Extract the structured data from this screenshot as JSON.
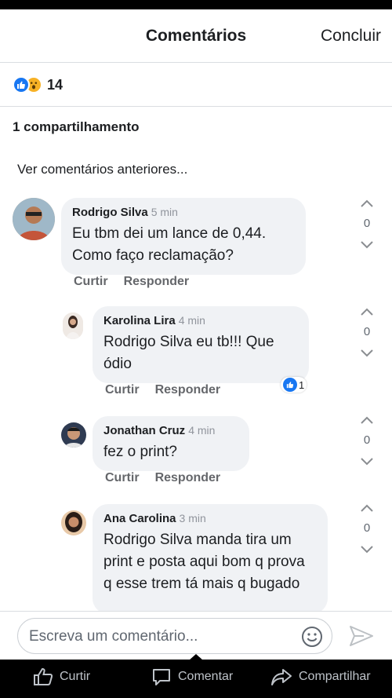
{
  "header": {
    "title": "Comentários",
    "done_label": "Concluir"
  },
  "reactions": {
    "types": [
      "like",
      "wow"
    ],
    "count": "14",
    "like_color": "#1877f2",
    "wow_color": "#f7b125"
  },
  "shares_label": "1 compartilhamento",
  "view_previous_label": "Ver comentários anteriores...",
  "comments": [
    {
      "author": "Rodrigo Silva",
      "time": "5 min",
      "text": "Eu tbm dei um lance de 0,44. Como faço reclamação?",
      "like_label": "Curtir",
      "reply_label": "Responder",
      "score": "0"
    },
    {
      "author": "Karolina Lira",
      "time": "4 min",
      "text": "Rodrigo Silva eu tb!!! Que ódio",
      "like_label": "Curtir",
      "reply_label": "Responder",
      "score": "0",
      "reaction_count": "1"
    },
    {
      "author": "Jonathan Cruz",
      "time": "4 min",
      "text": "fez o print?",
      "like_label": "Curtir",
      "reply_label": "Responder",
      "score": "0"
    },
    {
      "author": "Ana Carolina",
      "time": "3 min",
      "text": "Rodrigo Silva manda tira um print e posta aqui bom q prova q esse trem tá mais q bugado",
      "score": "0"
    }
  ],
  "composer": {
    "placeholder": "Escreva um comentário...",
    "emoji_icon": "emoji-icon",
    "send_icon": "send-icon"
  },
  "tabbar": {
    "like_label": "Curtir",
    "comment_label": "Comentar",
    "share_label": "Compartilhar"
  }
}
